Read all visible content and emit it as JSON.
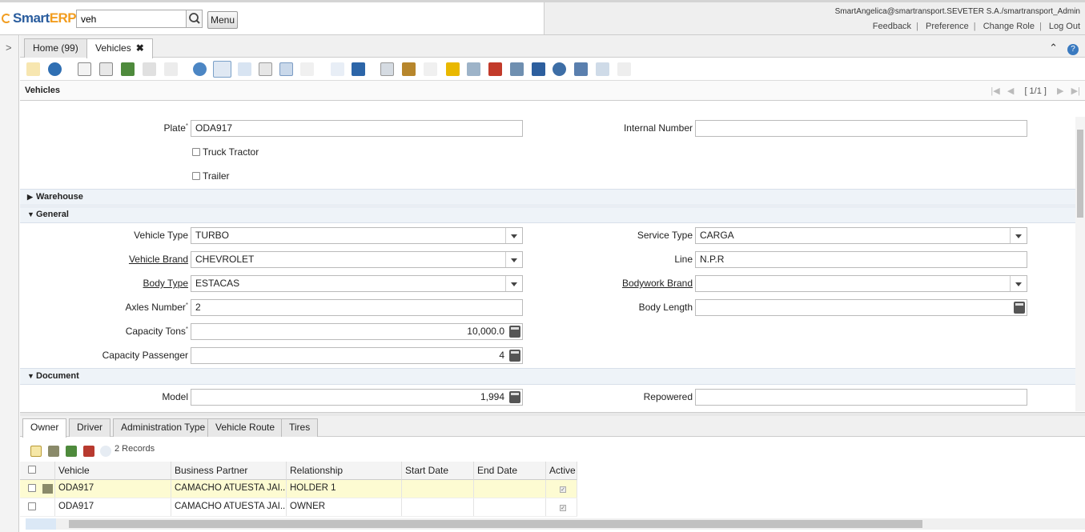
{
  "app": {
    "logo_smart": "Smart",
    "logo_erp": "ERP"
  },
  "search": {
    "value": "veh"
  },
  "menu_label": "Menu",
  "user": {
    "info": "SmartAngelica@smartransport.SEVETER S.A./smartransport_Admin"
  },
  "links": [
    "Feedback",
    "Preference",
    "Change Role",
    "Log Out"
  ],
  "window_tabs": [
    {
      "label": "Home (99)"
    },
    {
      "label": "Vehicles",
      "close": "✖"
    }
  ],
  "title": "Vehicles",
  "nav": {
    "record": "[ 1/1 ]"
  },
  "form": {
    "plate_label": "Plate",
    "plate_value": "ODA917",
    "internal_number_label": "Internal Number",
    "internal_number_value": "",
    "truck_tractor_label": "Truck Tractor",
    "trailer_label": "Trailer",
    "section_warehouse": "Warehouse",
    "section_general": "General",
    "vehicle_type_label": "Vehicle Type",
    "vehicle_type_value": "TURBO",
    "service_type_label": "Service Type",
    "service_type_value": "CARGA",
    "vehicle_brand_label": "Vehicle Brand",
    "vehicle_brand_value": "CHEVROLET",
    "line_label": "Line",
    "line_value": "N.P.R",
    "body_type_label": "Body Type",
    "body_type_value": "ESTACAS",
    "bodywork_brand_label": "Bodywork Brand",
    "bodywork_brand_value": "",
    "axles_label": "Axles Number",
    "axles_value": "2",
    "body_length_label": "Body Length",
    "body_length_value": "",
    "capacity_tons_label": "Capacity Tons",
    "capacity_tons_value": "10,000.0",
    "capacity_passenger_label": "Capacity Passenger",
    "capacity_passenger_value": "4",
    "section_document": "Document",
    "model_label": "Model",
    "model_value": "1,994",
    "repowered_label": "Repowered",
    "repowered_value": ""
  },
  "detail_tabs": [
    "Owner",
    "Driver",
    "Administration Type",
    "Vehicle Route",
    "Tires"
  ],
  "records": "2 Records",
  "grid": {
    "headers": [
      "Vehicle",
      "Business Partner",
      "Relationship",
      "Start Date",
      "End Date",
      "Active"
    ],
    "rows": [
      {
        "vehicle": "ODA917",
        "partner": "CAMACHO ATUESTA JAI...",
        "relationship": "HOLDER 1",
        "start": "",
        "end": "",
        "active": true
      },
      {
        "vehicle": "ODA917",
        "partner": "CAMACHO ATUESTA JAI...",
        "relationship": "OWNER",
        "start": "",
        "end": "",
        "active": true
      }
    ]
  },
  "colors": {
    "brand_blue": "#2a5d9e",
    "brand_orange": "#f29d1f",
    "section_bg": "#eef3f8",
    "selected_row": "#fdfbd2"
  }
}
